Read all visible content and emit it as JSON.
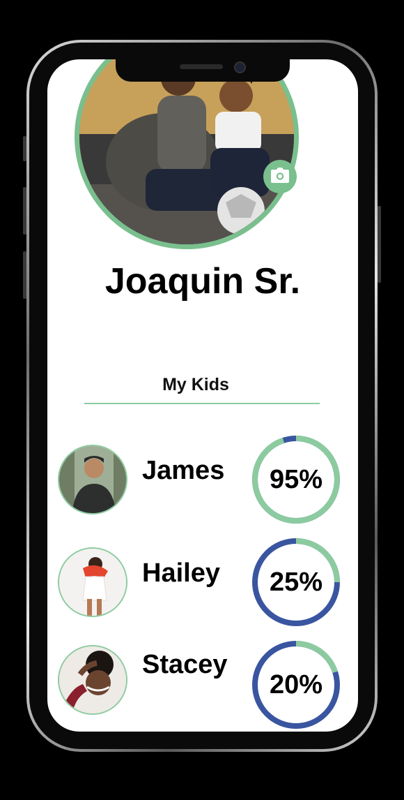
{
  "profile": {
    "name": "Joaquin Sr."
  },
  "section": {
    "title": "My Kids"
  },
  "kids": [
    {
      "name": "James",
      "progress_label": "95%",
      "progress": 95
    },
    {
      "name": "Hailey",
      "progress_label": "25%",
      "progress": 25
    },
    {
      "name": "Stacey",
      "progress_label": "20%",
      "progress": 20
    }
  ],
  "colors": {
    "accent_green": "#7abf8e",
    "ring_green": "#8ccb9f",
    "ring_blue": "#3a55a0",
    "background": "#ffffff"
  },
  "icons": {
    "camera": "camera-icon"
  }
}
